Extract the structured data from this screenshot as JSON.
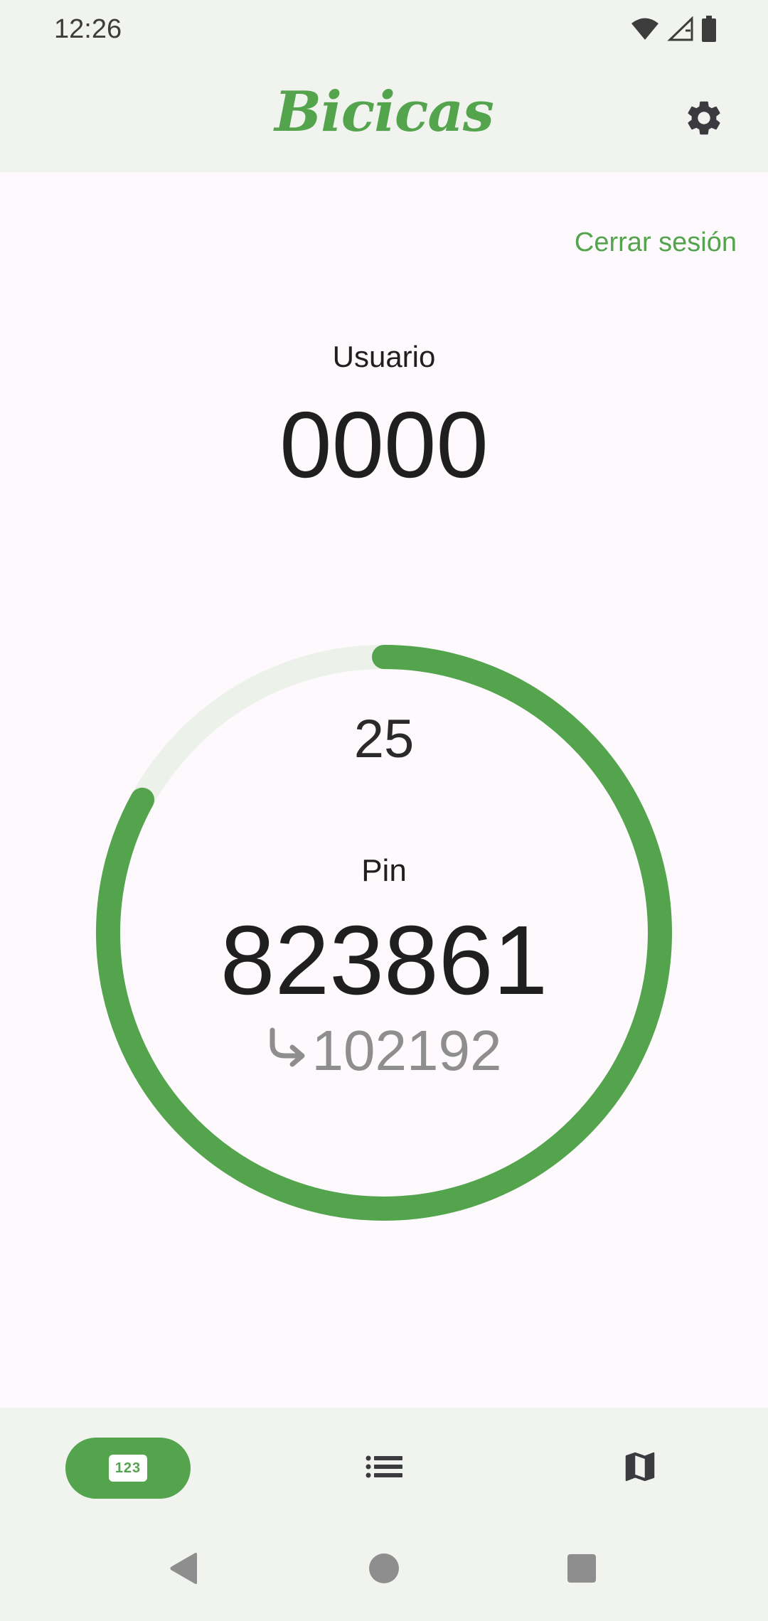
{
  "status_bar": {
    "time": "12:26",
    "icons": [
      "wifi-icon",
      "cellular-signal-icon",
      "battery-icon"
    ]
  },
  "app_bar": {
    "title": "Bicicas",
    "settings_icon": "gear-icon"
  },
  "main": {
    "logout_label": "Cerrar sesión",
    "user_label": "Usuario",
    "user_value": "0000",
    "countdown": "25",
    "countdown_progress": 0.83,
    "pin_label": "Pin",
    "pin_value": "823861",
    "next_pin_icon": "subdirectory-arrow-right-icon",
    "next_pin_value": "102192"
  },
  "bottom_nav": {
    "items": [
      {
        "icon": "pin-123-icon",
        "label": "123",
        "active": true
      },
      {
        "icon": "list-icon",
        "active": false
      },
      {
        "icon": "map-icon",
        "active": false
      }
    ]
  },
  "system_nav": {
    "icons": [
      "back-icon",
      "home-icon",
      "recents-icon"
    ]
  },
  "colors": {
    "accent": "#53a44d",
    "track": "#ecf1ea",
    "background": "#fdf9fc",
    "bar_background": "#f1f3ef"
  }
}
